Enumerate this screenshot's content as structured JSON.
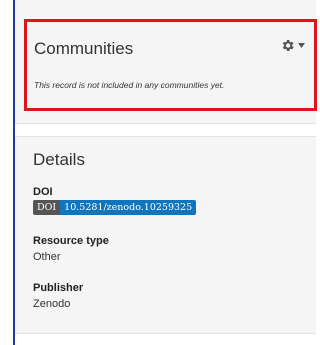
{
  "communities": {
    "title": "Communities",
    "empty_message": "This record is not included in any communities yet."
  },
  "details": {
    "title": "Details",
    "doi": {
      "label": "DOI",
      "badge_key": "DOI",
      "badge_value": "10.5281/zenodo.10259325"
    },
    "resource_type": {
      "label": "Resource type",
      "value": "Other"
    },
    "publisher": {
      "label": "Publisher",
      "value": "Zenodo"
    }
  },
  "colors": {
    "highlight_border": "#e0151c",
    "doi_badge_key_bg": "#555555",
    "doi_badge_value_bg": "#0f75bc",
    "frame_left": "#1f3a9e",
    "panel_bg": "#f5f5f5"
  },
  "icons": {
    "settings": "gear-icon",
    "dropdown": "caret-down-icon"
  }
}
